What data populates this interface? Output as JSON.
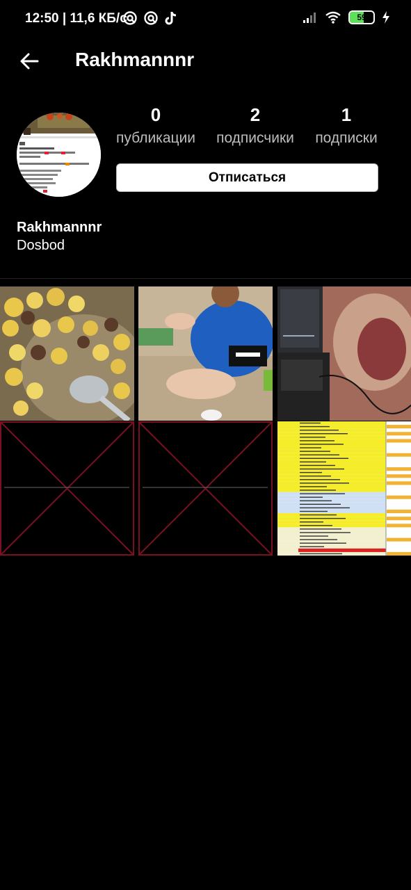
{
  "status_bar": {
    "time": "12:50 | 11,6 КБ/с",
    "battery_level": "59",
    "battery_fraction": 0.59,
    "icons": [
      "app-notification-icon",
      "app-notification-icon",
      "tiktok-icon",
      "signal-icon",
      "wifi-icon",
      "battery-icon",
      "charging-icon"
    ]
  },
  "header": {
    "title": "Rakhmannnr",
    "back_icon": "arrow-left-icon"
  },
  "profile": {
    "stats": [
      {
        "value": "0",
        "label": "публикации"
      },
      {
        "value": "2",
        "label": "подписчики"
      },
      {
        "value": "1",
        "label": "подписки"
      }
    ],
    "unfollow_label": "Отписаться",
    "name": "Rakhmannnr",
    "bio": "Dosbod"
  },
  "posts": [
    {
      "kind": "photo",
      "subject": "stew with potatoes"
    },
    {
      "kind": "photo",
      "subject": "child playing in sand"
    },
    {
      "kind": "photo",
      "subject": "laptop on carpet"
    },
    {
      "kind": "broken"
    },
    {
      "kind": "broken"
    },
    {
      "kind": "photo",
      "subject": "spreadsheet"
    }
  ],
  "colors": {
    "background": "#000000",
    "broken_border": "#7a1022",
    "battery_fill": "#5ee15a",
    "spreadsheet_yellow": "#f5ec2a"
  }
}
